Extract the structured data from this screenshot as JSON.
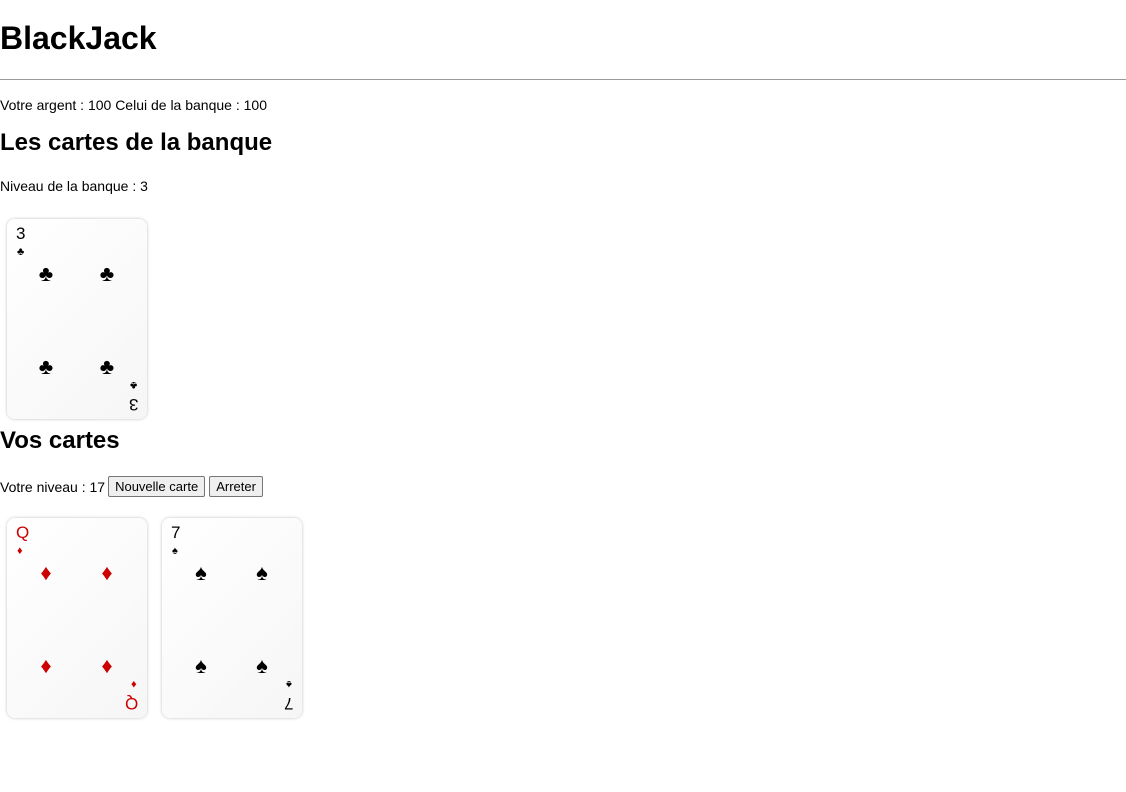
{
  "app": {
    "title": "BlackJack"
  },
  "money": {
    "text": "Votre argent : 100 Celui de la banque : 100"
  },
  "bank": {
    "title": "Les cartes de la banque",
    "level_text": "Niveau de la banque : 3",
    "cards": [
      {
        "rank": "3",
        "suit": "♣",
        "suit_name": "clubs",
        "color": "#000000"
      }
    ]
  },
  "player": {
    "title": "Vos cartes",
    "level_text": "Votre niveau : 17",
    "new_card_label": "Nouvelle carte",
    "stop_label": "Arreter",
    "cards": [
      {
        "rank": "Q",
        "suit": "♦",
        "suit_name": "diamonds",
        "color": "#cc0000"
      },
      {
        "rank": "7",
        "suit": "♠",
        "suit_name": "spades",
        "color": "#000000"
      }
    ]
  }
}
